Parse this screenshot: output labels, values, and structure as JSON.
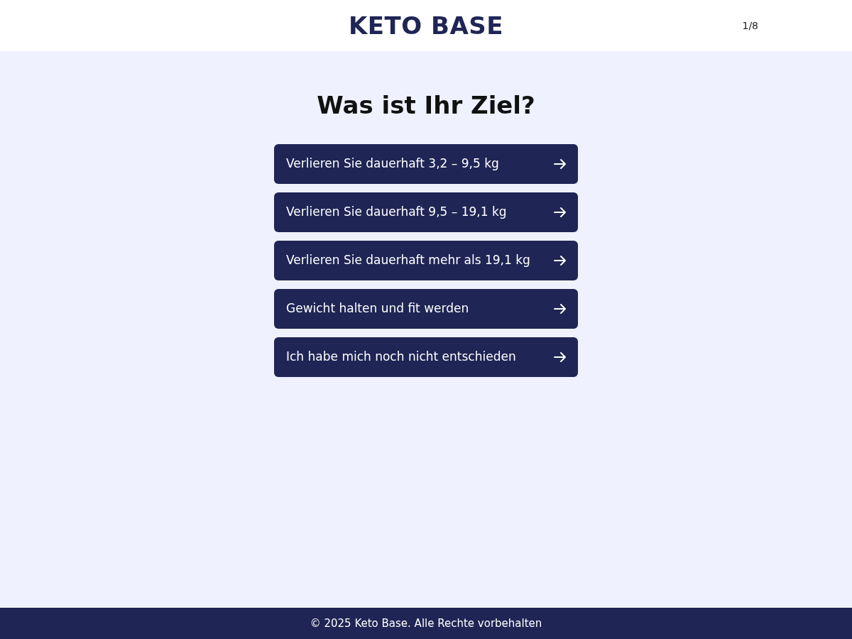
{
  "header": {
    "logo": "KETO BASE",
    "progress": "1/8"
  },
  "question": "Was ist Ihr Ziel?",
  "options": [
    {
      "label": "Verlieren Sie dauerhaft 3,2 – 9,5 kg"
    },
    {
      "label": "Verlieren Sie dauerhaft 9,5 – 19,1 kg"
    },
    {
      "label": "Verlieren Sie dauerhaft mehr als 19,1 kg"
    },
    {
      "label": "Gewicht halten und fit werden"
    },
    {
      "label": "Ich habe mich noch nicht entschieden"
    }
  ],
  "footer": "© 2025 Keto Base. Alle Rechte vorbehalten"
}
